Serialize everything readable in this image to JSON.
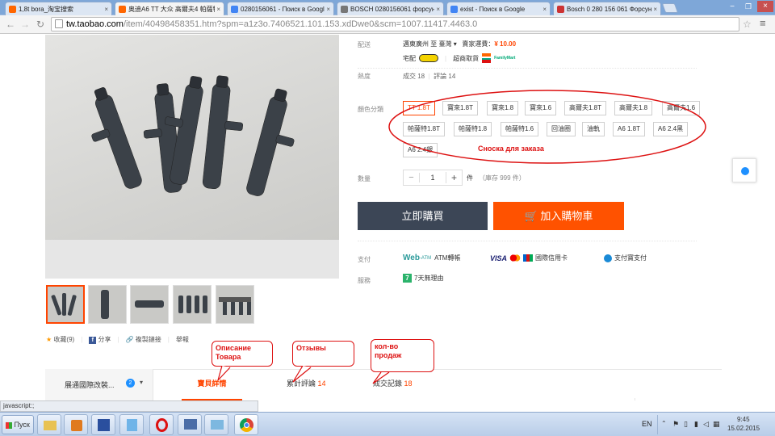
{
  "browser": {
    "tabs": [
      {
        "label": "1,8t bora_淘宝搜索",
        "color": "#f60"
      },
      {
        "label": "奥迪A6 TT 大众 高爾夫4 帕薩特",
        "color": "#f60"
      },
      {
        "label": "0280156061 - Поиск в Google",
        "color": "#4285f4"
      },
      {
        "label": "BOSCH 0280156061 форсун",
        "color": "#777"
      },
      {
        "label": "exist - Поиск в Google",
        "color": "#4285f4"
      },
      {
        "label": "Bosch 0 280 156 061 Форсун",
        "color": "#c33"
      }
    ],
    "url_host": "tw.taobao.com",
    "url_path": "/item/40498458351.htm?spm=a1z3o.7406521.101.153.xdDwe0&scm=1007.11417.4463.0"
  },
  "product": {
    "shipping_label": "配送",
    "shipping_from": "邁東廣州 至 臺灣",
    "shipping_fee_label": "賣家運費：",
    "shipping_fee": "¥ 10.00",
    "delivery_home": "宅配",
    "delivery_store": "超商取貨",
    "delivery_store_brand": "FamilyMart",
    "popularity_label": "熱度",
    "sold_label": "成交",
    "sold_count": "18",
    "reviews_label": "評論",
    "reviews_count": "14",
    "color_label": "顏色分類",
    "sku_options": [
      "TT 1.8T",
      "寶來1.8T",
      "寶來1.8",
      "寶來1.6",
      "高爾夫1.8T",
      "高爾夫1.8",
      "高爾夫1.6",
      "帕薩特1.8T",
      "帕薩特1.8",
      "帕薩特1.6",
      "回油圈",
      "油軌",
      "A6 1.8T",
      "A6 2.4黑",
      "A6 2.4銀"
    ],
    "qty_label": "數量",
    "qty_minus": "−",
    "qty_value": "1",
    "qty_plus": "+",
    "qty_unit": "件",
    "stock": "（庫存 999 件）",
    "buy_now": "立即購買",
    "add_cart": "加入購物車",
    "payment_label": "支付",
    "pay_webatm": "Web",
    "pay_webatm_sub": "-ATM",
    "pay_webatm_text": "ATM轉帳",
    "pay_visa": "VISA",
    "pay_cards_text": "國際信用卡",
    "pay_alipay_text": "支付寶支付",
    "service_label": "服務",
    "service_badge": "7",
    "service_text": "7天無理由",
    "favorite": "收藏(9)",
    "share": "分享",
    "copy_link": "複製鏈接",
    "report": "舉報"
  },
  "tabs_bottom": {
    "store_name": "展通國際改裝...",
    "store_badge": "2",
    "description": "寶貝詳情",
    "reviews": "累計評論",
    "reviews_count": "14",
    "sales": "成交記錄",
    "sales_count": "18"
  },
  "annotations": {
    "order_footnote": "Сноска для заказа",
    "description": "Описание\nТовара",
    "reviews": "Отзывы",
    "sales": "кол-во\nпродаж"
  },
  "status_text": "javascript:;",
  "taskbar": {
    "start": "Пуск",
    "lang": "EN",
    "time": "9:45",
    "date": "15.02.2015"
  }
}
